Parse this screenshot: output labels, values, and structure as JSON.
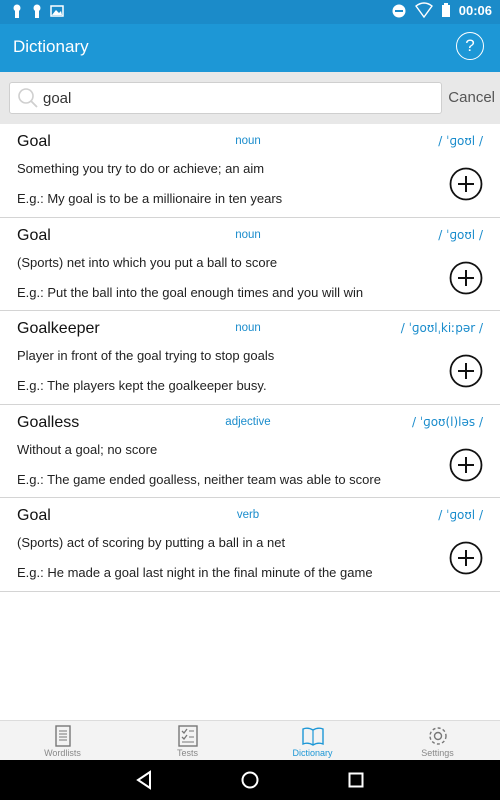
{
  "status_bar": {
    "time": "00:06",
    "left_icons": [
      "lock-icon",
      "lock-icon",
      "image-icon"
    ],
    "right_icons": [
      "do-not-disturb-icon",
      "wifi-icon",
      "battery-icon"
    ]
  },
  "app_bar": {
    "title": "Dictionary",
    "help_label": "?"
  },
  "search": {
    "value": "goal",
    "cancel_label": "Cancel"
  },
  "entries": [
    {
      "word": "Goal",
      "pos": "noun",
      "pron": "/ ˈɡoʊl /",
      "definition": "Something you try to do or achieve; an aim",
      "example": "E.g.: My goal is to be a millionaire in ten years"
    },
    {
      "word": "Goal",
      "pos": "noun",
      "pron": "/ ˈɡoʊl /",
      "definition": "(Sports) net into which you put a ball to score",
      "example": "E.g.: Put the ball into the goal enough times and you will win"
    },
    {
      "word": "Goalkeeper",
      "pos": "noun",
      "pron": "/ ˈɡoʊlˌkiːpər /",
      "definition": "Player in front of the goal trying to stop goals",
      "example": "E.g.: The players kept the goalkeeper busy."
    },
    {
      "word": "Goalless",
      "pos": "adjective",
      "pron": "/ ˈɡoʊ(l)ləs /",
      "definition": "Without a goal; no score",
      "example": "E.g.: The game ended goalless, neither team was able to score"
    },
    {
      "word": "Goal",
      "pos": "verb",
      "pron": "/ ˈɡoʊl /",
      "definition": "(Sports) act of scoring by putting a ball in a net",
      "example": "E.g.: He made a goal last night in the final minute of the game"
    }
  ],
  "bottom_nav": [
    {
      "label": "Wordlists",
      "icon": "notebook-icon",
      "active": false
    },
    {
      "label": "Tests",
      "icon": "checklist-icon",
      "active": false
    },
    {
      "label": "Dictionary",
      "icon": "book-icon",
      "active": true
    },
    {
      "label": "Settings",
      "icon": "gear-icon",
      "active": false
    }
  ],
  "colors": {
    "status_bar": "#1b8bc9",
    "app_bar": "#1d97d6",
    "accent": "#1a8ccc"
  }
}
